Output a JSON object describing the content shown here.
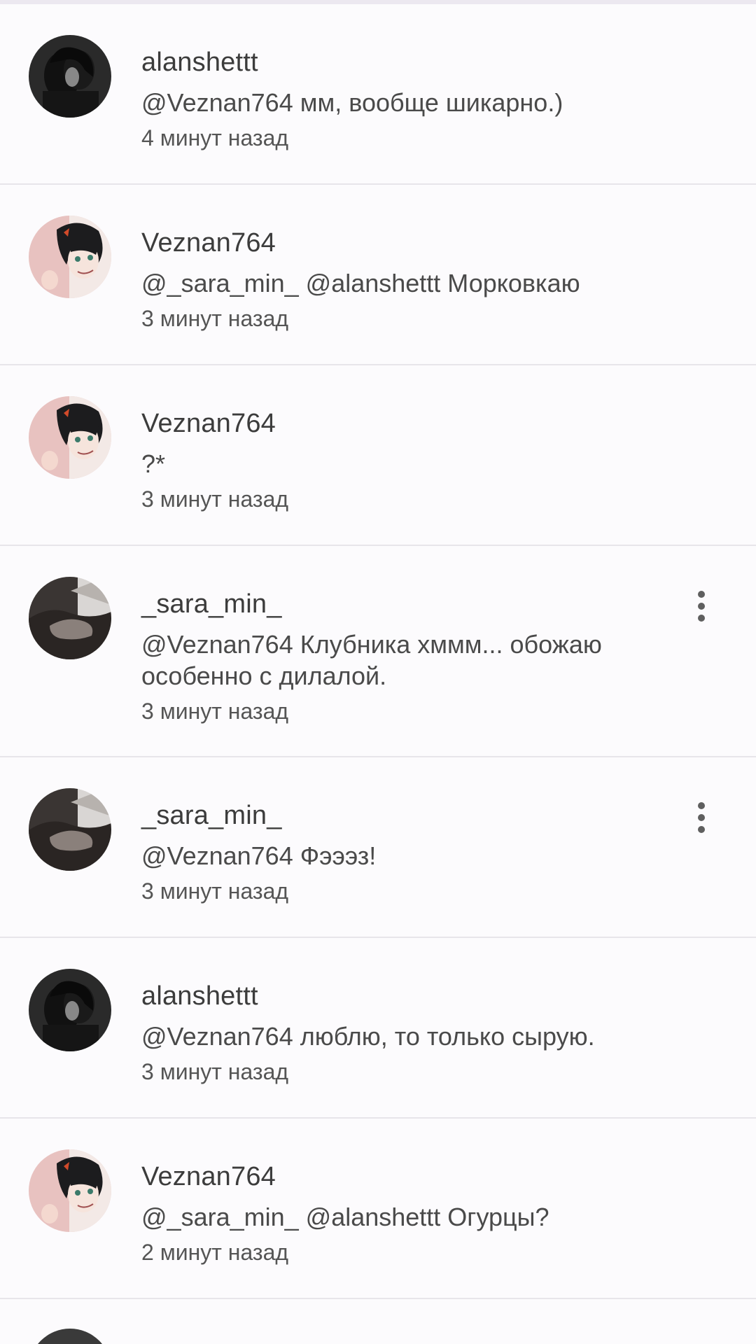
{
  "comments": [
    {
      "user": "alanshettt",
      "text": "@Veznan764  мм, вообще шикарно.)",
      "time": "4 минут назад",
      "avatar": "dark-couple-avatar"
    },
    {
      "user": "Veznan764",
      "text": "@_sara_min_  @alanshettt  Морковкаю",
      "time": "3 минут назад",
      "avatar": "anime-boy-avatar"
    },
    {
      "user": "Veznan764",
      "text": "?*",
      "time": "3 минут назад",
      "avatar": "anime-boy-avatar"
    },
    {
      "user": "_sara_min_",
      "text": "@Veznan764  Клубника хммм... обожаю особенно с дилалой.",
      "time": "3 минут назад",
      "avatar": "hand-photo-avatar",
      "has_menu": true
    },
    {
      "user": "_sara_min_",
      "text": "@Veznan764  Фэээз!",
      "time": "3 минут назад",
      "avatar": "hand-photo-avatar",
      "has_menu": true
    },
    {
      "user": "alanshettt",
      "text": "@Veznan764  люблю, то только сырую.",
      "time": "3 минут назад",
      "avatar": "dark-couple-avatar"
    },
    {
      "user": "Veznan764",
      "text": "@_sara_min_  @alanshettt  Огурцы?",
      "time": "2 минут назад",
      "avatar": "anime-boy-avatar"
    }
  ],
  "colors": {
    "background": "#fcfbfd",
    "divider": "#e7e5ea",
    "username": "#3c3c3c",
    "text": "#4a4a4a",
    "menu_dots": "#5f5f5f"
  },
  "icons": {
    "more": "more-vertical-icon"
  }
}
